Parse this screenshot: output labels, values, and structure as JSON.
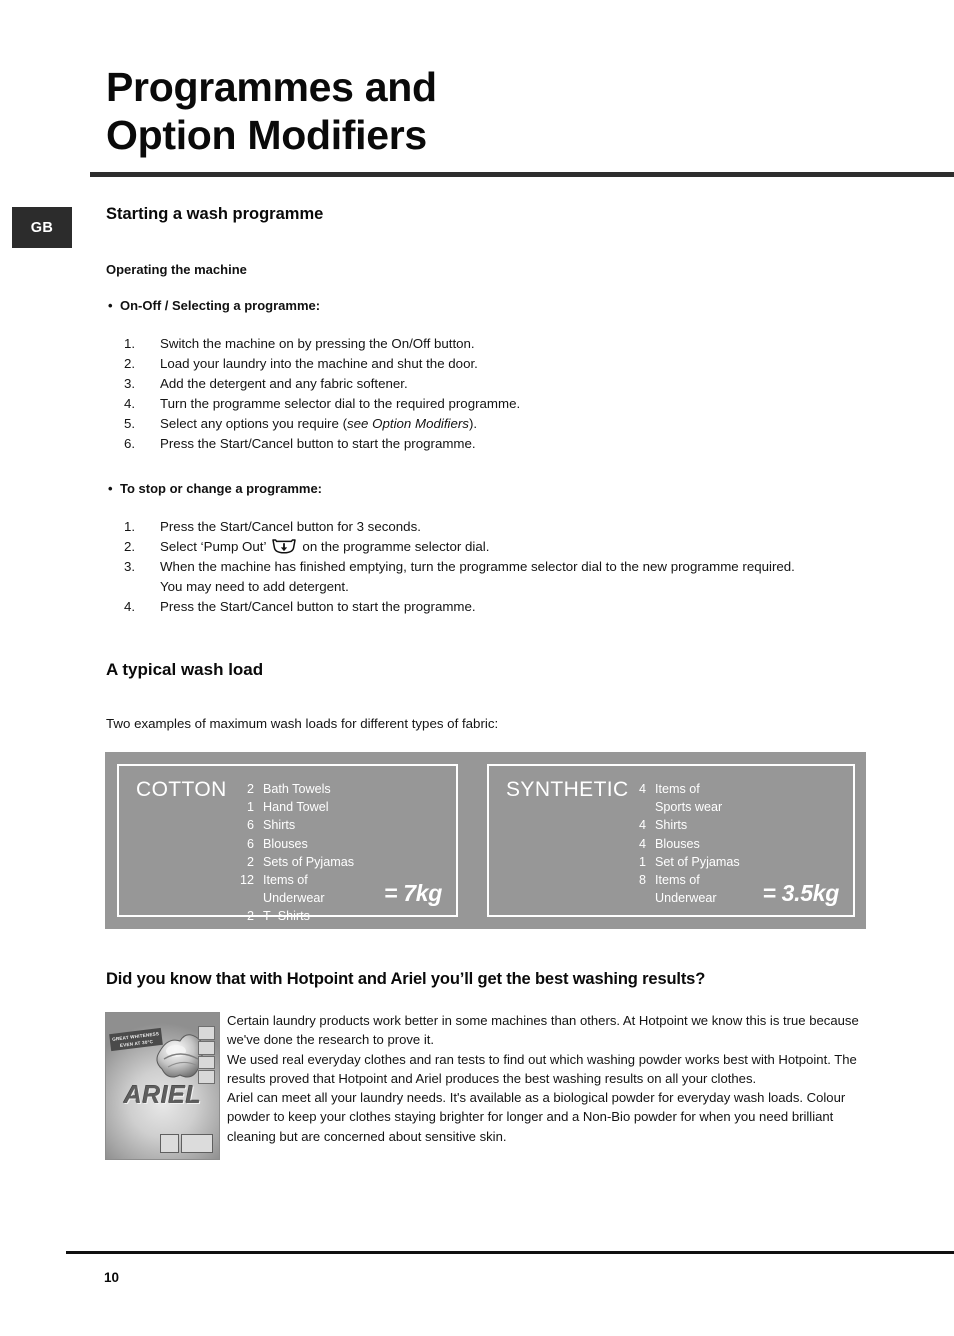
{
  "document": {
    "title_lines": [
      "Programmes and",
      "Option Modifiers"
    ],
    "locale_badge": "GB",
    "page_number": "10"
  },
  "sections": {
    "starting": {
      "heading": "Starting a wash programme",
      "subheading": "Operating the machine",
      "bullet_onoff": "On-Off / Selecting a programme:",
      "steps_onoff": [
        {
          "num": "1.",
          "text": "Switch the machine on by pressing the On/Off button."
        },
        {
          "num": "2.",
          "text": "Load your laundry into the machine and shut the door."
        },
        {
          "num": "3.",
          "text": "Add the detergent and any fabric softener."
        },
        {
          "num": "4.",
          "text": "Turn the programme selector dial to the required programme."
        },
        {
          "num": "5.",
          "text_before": "Select any options you require (",
          "text_italic": "see Option Modifiers",
          "text_after": ")."
        },
        {
          "num": "6.",
          "text": "Press the Start/Cancel button to start the programme."
        }
      ],
      "bullet_stop": "To stop or change a programme:",
      "steps_stop": [
        {
          "num": "1.",
          "text": "Press the Start/Cancel button for 3 seconds."
        },
        {
          "num": "2.",
          "text_before": "Select ‘Pump Out’",
          "text_after": "on the programme selector dial."
        },
        {
          "num": "3.",
          "text": "When the machine has finished emptying, turn the programme selector dial to the new programme required.\nYou may need to add detergent."
        },
        {
          "num": "4.",
          "text": "Press the Start/Cancel button to start the programme."
        }
      ]
    },
    "typical_load": {
      "heading": "A typical wash load",
      "intro": "Two examples of maximum wash loads for different types of fabric:",
      "panels": [
        {
          "title": "COTTON",
          "items": [
            {
              "qty": "2",
              "label": "Bath Towels"
            },
            {
              "qty": "1",
              "label": "Hand Towel"
            },
            {
              "qty": "6",
              "label": "Shirts"
            },
            {
              "qty": "6",
              "label": "Blouses"
            },
            {
              "qty": "2",
              "label": "Sets of Pyjamas"
            },
            {
              "qty": "12",
              "label": "Items of\nUnderwear"
            },
            {
              "qty": "2",
              "label": "T–Shirts"
            }
          ],
          "weight": "= 7kg"
        },
        {
          "title": "SYNTHETIC",
          "items": [
            {
              "qty": "4",
              "label": "Items of\nSports wear"
            },
            {
              "qty": "4",
              "label": "Shirts"
            },
            {
              "qty": "4",
              "label": "Blouses"
            },
            {
              "qty": "1",
              "label": "Set of Pyjamas"
            },
            {
              "qty": "8",
              "label": "Items of\nUnderwear"
            }
          ],
          "weight": "= 3.5kg"
        }
      ]
    },
    "ariel": {
      "heading": "Did you know that with Hotpoint and Ariel you’ll get the best washing results?",
      "paragraphs": [
        "Certain laundry products work better in some machines than others. At Hotpoint we know this is true because we've done the research to prove it.",
        "We used real everyday clothes and ran tests to find out which washing powder works best with Hotpoint. The results proved that Hotpoint and Ariel produces the best washing results on all your clothes.",
        "Ariel can meet all your laundry needs. It's available as a biological powder for everyday wash loads. Colour powder to keep your clothes staying brighter for longer and a Non-Bio powder for when you need brilliant cleaning but are concerned about sensitive skin."
      ],
      "pack": {
        "brand": "ARIEL",
        "banner_line1": "GREAT WHITENESS",
        "banner_line2": "EVEN AT 30°C"
      }
    }
  },
  "colors": {
    "rule": "#2e2e2e",
    "badge_bg": "#2c2c2c",
    "panel_gray": "#979797",
    "panel_border": "#ffffff",
    "text": "#141414"
  }
}
